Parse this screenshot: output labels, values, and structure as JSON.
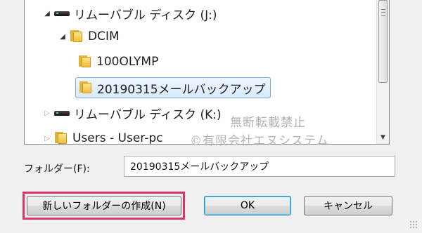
{
  "tree": {
    "items": [
      {
        "label": "リムーバブル ディスク (J:)",
        "expanded": true,
        "icon": "removable-drive-icon"
      },
      {
        "label": "DCIM",
        "expanded": true,
        "icon": "folder-icon"
      },
      {
        "label": "100OLYMP",
        "icon": "folder-icon"
      },
      {
        "label": "20190315メールバックアップ",
        "selected": true,
        "icon": "folder-icon"
      },
      {
        "label": "リムーバブル ディスク (K:)",
        "expanded": false,
        "icon": "removable-drive-icon"
      },
      {
        "label": "Users - User-pc",
        "expanded": false,
        "icon": "folder-icon"
      }
    ]
  },
  "watermark": {
    "line1": "無断転載禁止",
    "line2": "©有限会社エヌシステム"
  },
  "folder_field": {
    "label": "フォルダー(F):",
    "value": "20190315メールバックアップ"
  },
  "buttons": {
    "new_folder": "新しいフォルダーの作成(N)",
    "ok": "OK",
    "cancel": "キャンセル"
  },
  "colors": {
    "highlight": "#d9366a",
    "selection": "#d8ebfc"
  }
}
